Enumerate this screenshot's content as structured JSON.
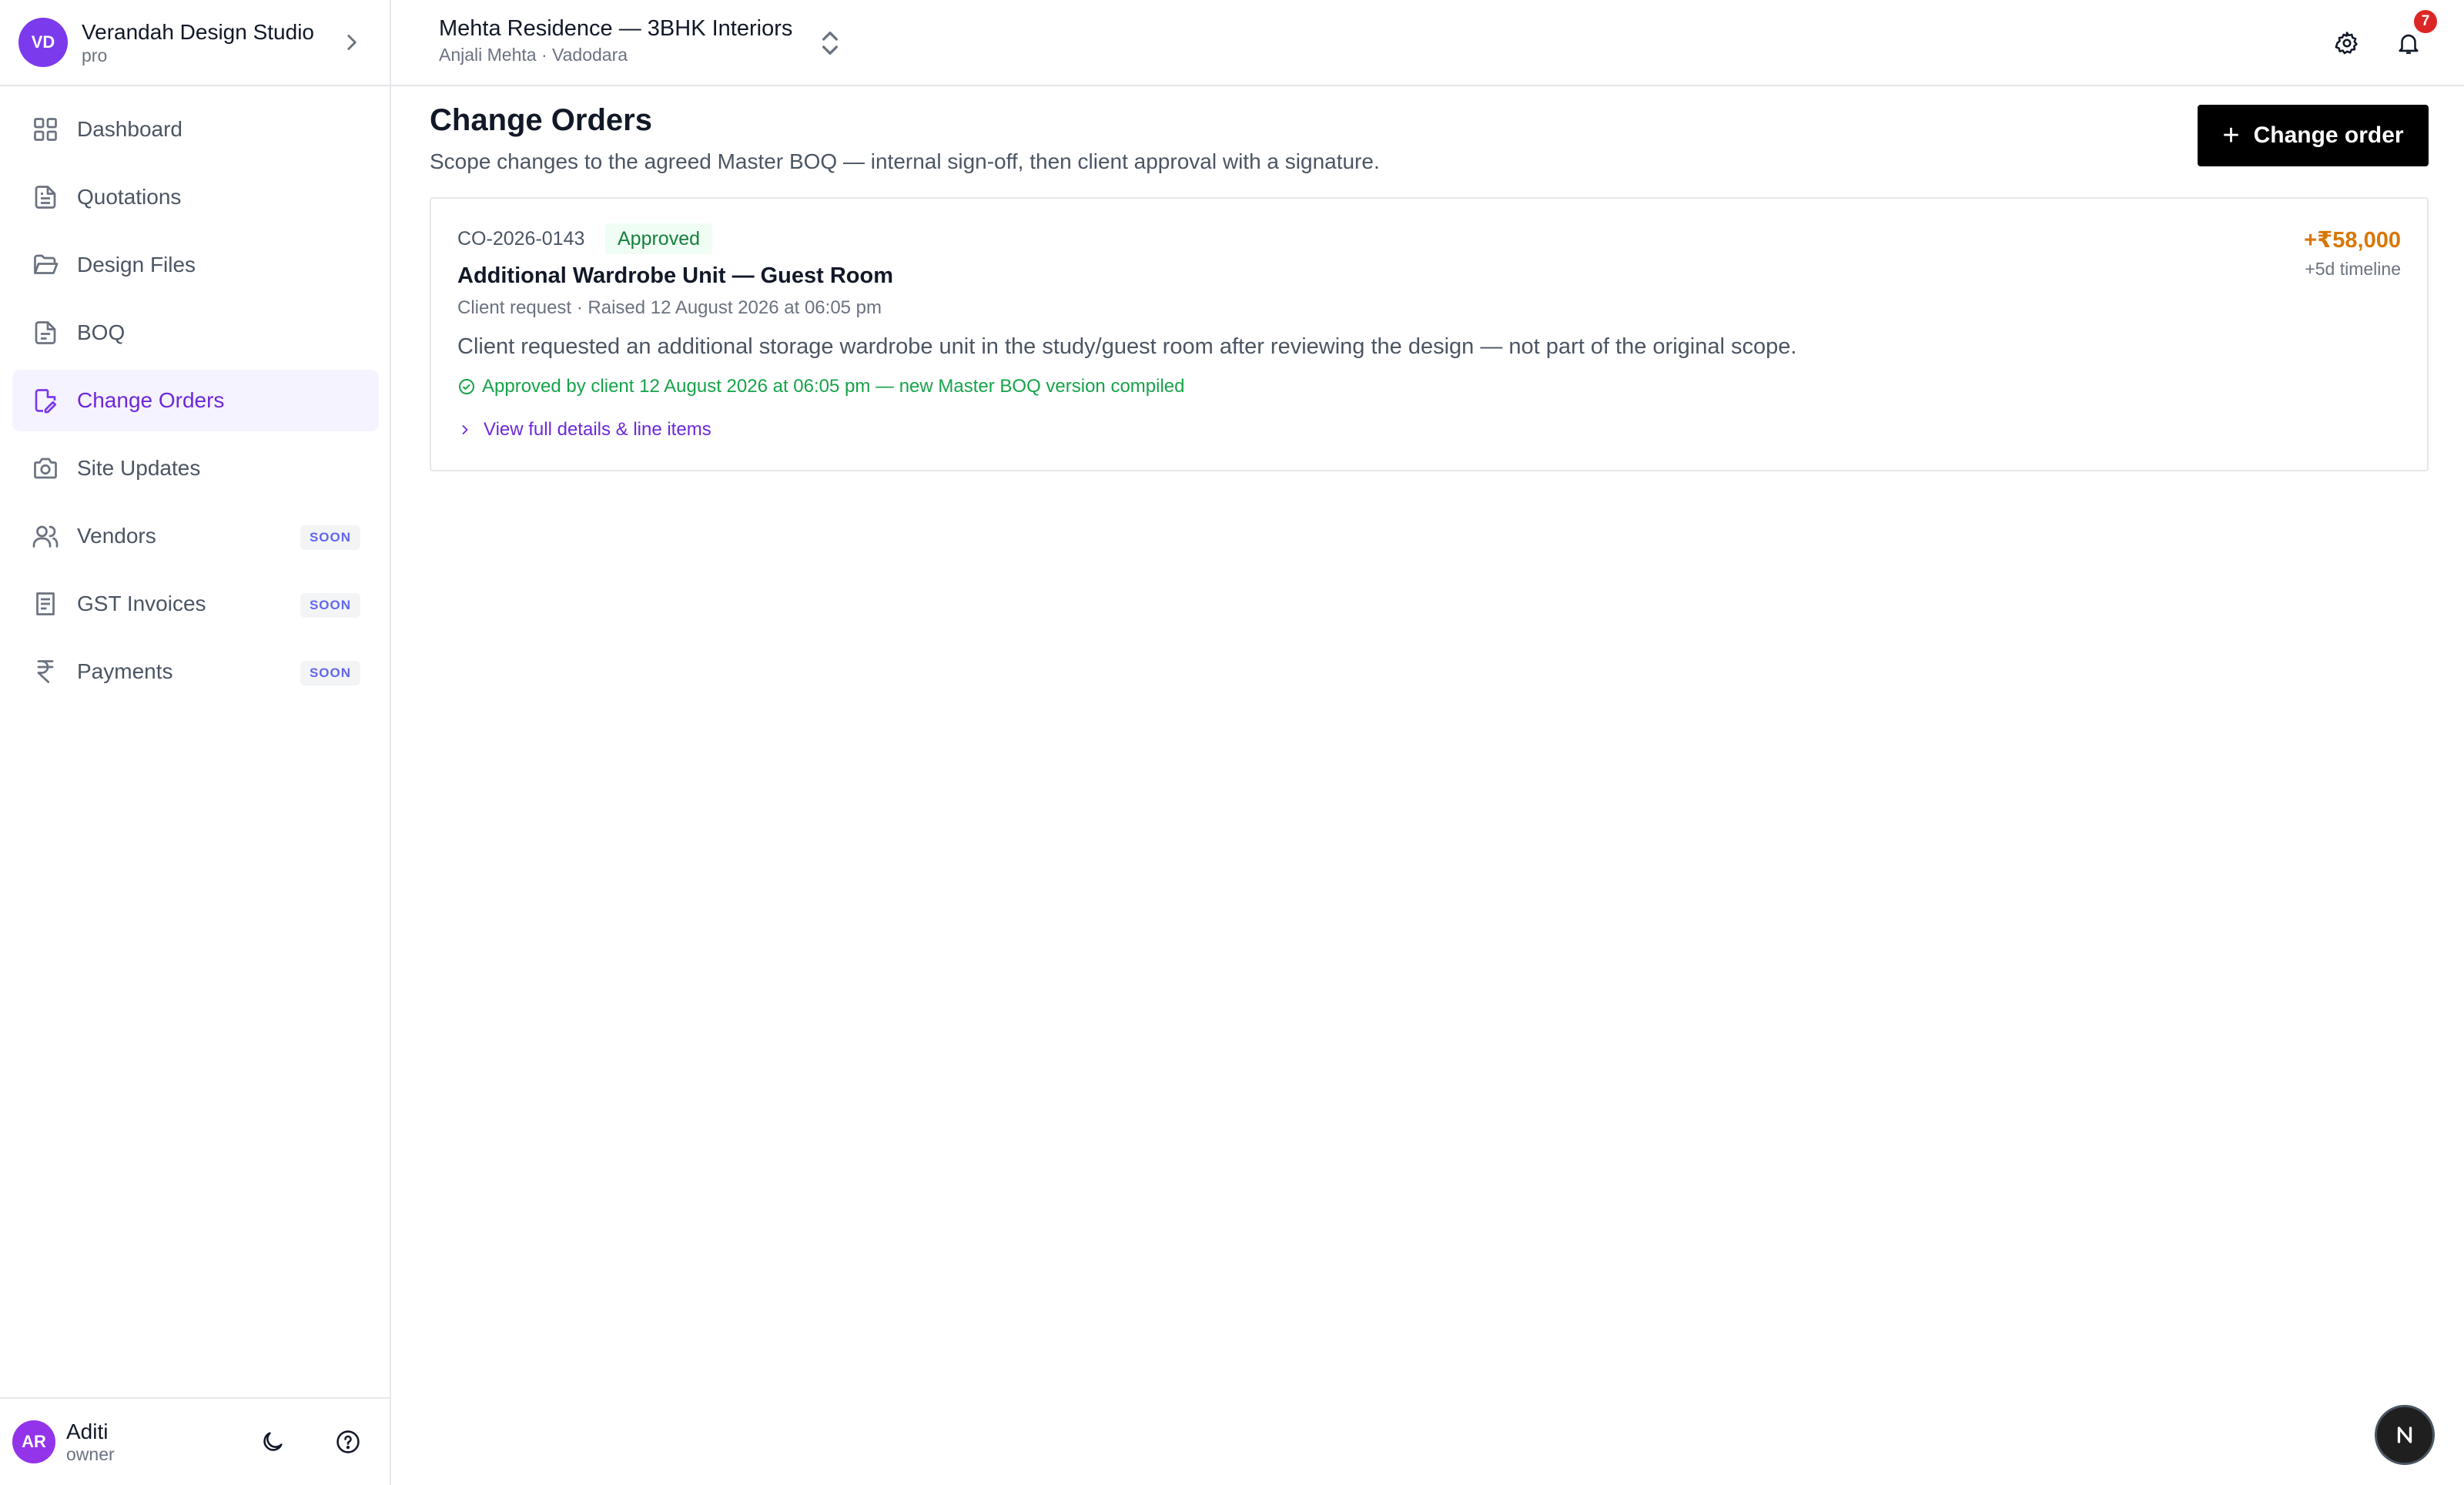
{
  "workspace": {
    "initials": "VD",
    "name": "Verandah Design Studio",
    "plan": "pro"
  },
  "nav": {
    "items": [
      {
        "label": "Dashboard",
        "icon": "grid-icon"
      },
      {
        "label": "Quotations",
        "icon": "file-text-icon"
      },
      {
        "label": "Design Files",
        "icon": "folder-open-icon"
      },
      {
        "label": "BOQ",
        "icon": "file-list-icon"
      },
      {
        "label": "Change Orders",
        "icon": "file-edit-icon",
        "active": true
      },
      {
        "label": "Site Updates",
        "icon": "camera-icon"
      },
      {
        "label": "Vendors",
        "icon": "users-icon",
        "badge": "SOON"
      },
      {
        "label": "GST Invoices",
        "icon": "receipt-icon",
        "badge": "SOON"
      },
      {
        "label": "Payments",
        "icon": "rupee-icon",
        "badge": "SOON"
      }
    ]
  },
  "user": {
    "initials": "AR",
    "name": "Aditi",
    "role": "owner"
  },
  "project": {
    "name": "Mehta Residence — 3BHK Interiors",
    "subtitle": "Anjali Mehta · Vadodara"
  },
  "notifications": {
    "count": "7"
  },
  "page": {
    "title": "Change Orders",
    "subtitle": "Scope changes to the agreed Master BOQ — internal sign-off, then client approval with a signature.",
    "new_button": "Change order"
  },
  "change_orders": [
    {
      "id": "CO-2026-0143",
      "status": "Approved",
      "title": "Additional Wardrobe Unit — Guest Room",
      "meta": "Client request · Raised 12 August 2026 at 06:05 pm",
      "description": "Client requested an additional storage wardrobe unit in the study/guest room after reviewing the design — not part of the original scope.",
      "approval": "Approved by client 12 August 2026 at 06:05 pm — new Master BOQ version compiled",
      "link": "View full details & line items",
      "amount": "+₹58,000",
      "timeline": "+5d timeline"
    }
  ],
  "colors": {
    "accent": "#6d28d9",
    "approved": "#16a34a",
    "amount": "#d97706",
    "badge": "#dc2626"
  }
}
